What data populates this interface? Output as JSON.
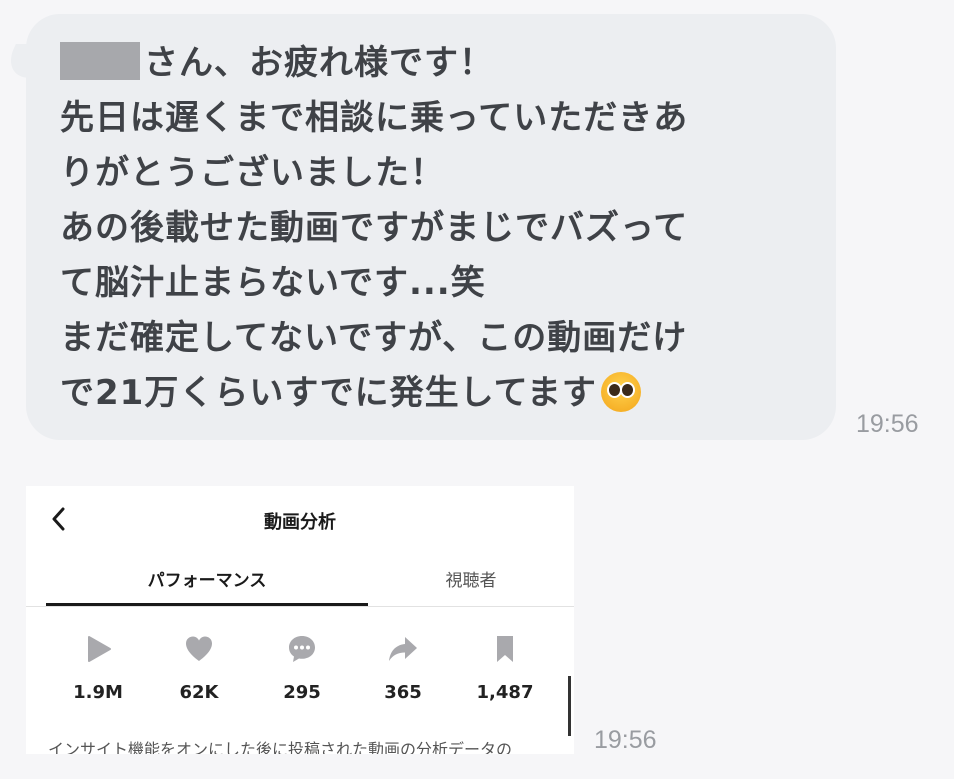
{
  "message": {
    "lines": [
      "さん、お疲れ様です！",
      "先日は遅くまで相談に乗っていただきあ",
      "りがとうございました！",
      "あの後載せた動画ですがまじでバズって",
      "て脳汁止まらないです...笑",
      "まだ確定してないですが、この動画だけ",
      "で21万くらいすでに発生してます"
    ],
    "emoji": "pleading-face-emoji",
    "time": "19:56"
  },
  "screenshot": {
    "title": "動画分析",
    "tabs": [
      "パフォーマンス",
      "視聴者"
    ],
    "stats": [
      {
        "icon": "play-icon",
        "value": "1.9M"
      },
      {
        "icon": "heart-icon",
        "value": "62K"
      },
      {
        "icon": "comment-icon",
        "value": "295"
      },
      {
        "icon": "share-icon",
        "value": "365"
      },
      {
        "icon": "bookmark-icon",
        "value": "1,487"
      }
    ],
    "footer": "インサイト機能をオンにした後に投稿された動画の分析データの",
    "time": "19:56"
  },
  "colors": {
    "bubble": "#eceef1",
    "text": "#3f4247",
    "icon_gray": "#a9a9ad"
  }
}
